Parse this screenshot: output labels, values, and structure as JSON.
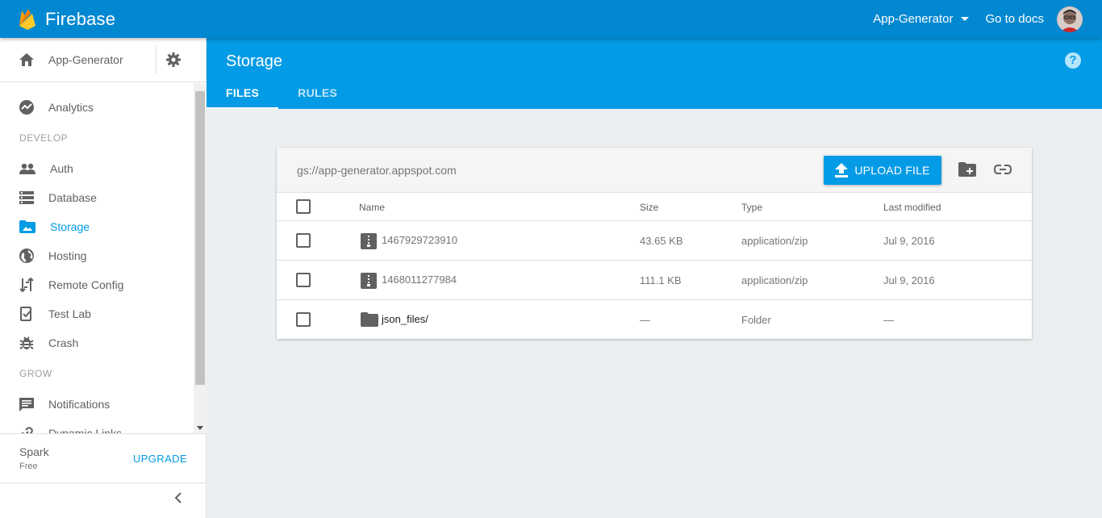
{
  "app": {
    "brand": "Firebase",
    "project_selector": "App-Generator",
    "docs_link": "Go to docs"
  },
  "sidebar": {
    "project_name": "App-Generator",
    "analytics": "Analytics",
    "develop_label": "DEVELOP",
    "develop_items": [
      {
        "label": "Auth",
        "icon": "people-icon"
      },
      {
        "label": "Database",
        "icon": "database-icon"
      },
      {
        "label": "Storage",
        "icon": "storage-folder-icon",
        "active": true
      },
      {
        "label": "Hosting",
        "icon": "globe-icon"
      },
      {
        "label": "Remote Config",
        "icon": "remote-config-icon"
      },
      {
        "label": "Test Lab",
        "icon": "test-lab-icon"
      },
      {
        "label": "Crash",
        "icon": "bug-icon"
      }
    ],
    "grow_label": "GROW",
    "grow_items": [
      {
        "label": "Notifications",
        "icon": "message-icon"
      },
      {
        "label": "Dynamic Links",
        "icon": "link-icon"
      }
    ],
    "plan": {
      "name": "Spark",
      "tier": "Free",
      "upgrade": "UPGRADE"
    }
  },
  "page": {
    "title": "Storage",
    "tabs": [
      "FILES",
      "RULES"
    ],
    "active_tab": "FILES",
    "help": "?"
  },
  "storage": {
    "bucket": "gs://app-generator.appspot.com",
    "upload_label": "UPLOAD FILE",
    "columns": [
      "Name",
      "Size",
      "Type",
      "Last modified"
    ],
    "files": [
      {
        "name": "1467929723910",
        "size": "43.65 KB",
        "type": "application/zip",
        "modified": "Jul 9, 2016",
        "icon": "zip-file-icon"
      },
      {
        "name": "1468011277984",
        "size": "111.1 KB",
        "type": "application/zip",
        "modified": "Jul 9, 2016",
        "icon": "zip-file-icon"
      },
      {
        "name": "json_files/",
        "size": "—",
        "type": "Folder",
        "modified": "—",
        "icon": "folder-icon"
      }
    ]
  },
  "colors": {
    "topbar": "#0288d1",
    "header": "#039be5",
    "accent": "#039be5",
    "background": "#eceff1"
  }
}
